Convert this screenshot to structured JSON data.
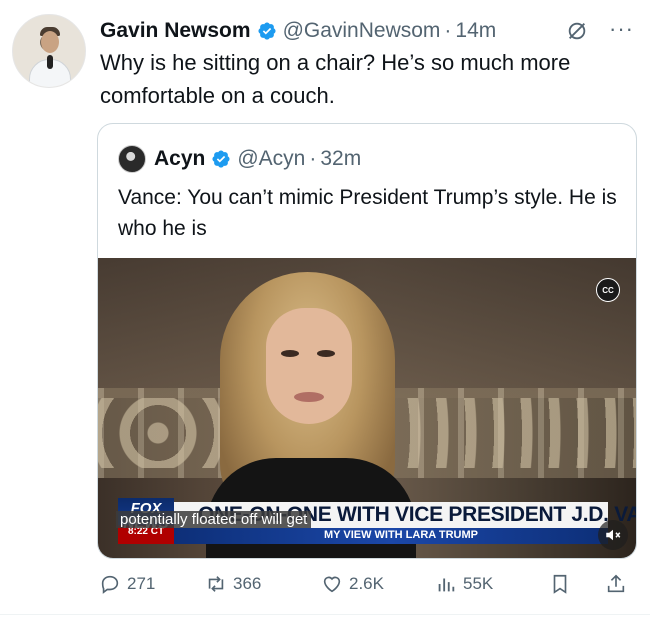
{
  "tweet": {
    "author_name": "Gavin Newsom",
    "author_handle": "@GavinNewsom",
    "separator": "·",
    "time": "14m",
    "more_label": "···",
    "text": "Why is he sitting on a chair? He’s so much more comfortable on a couch."
  },
  "quote": {
    "author_name": "Acyn",
    "author_handle": "@Acyn",
    "separator": "·",
    "time": "32m",
    "text": "Vance: You can’t mimic President Trump’s style. He is who he is"
  },
  "video": {
    "cc_label": "CC",
    "network_logo": "FOX NEWS",
    "clock": "8:22 CT",
    "headline": "ONE-ON-ONE WITH VICE PRESIDENT J.D. VANCE",
    "show_bar": "MY VIEW WITH LARA TRUMP",
    "caption": "potentially floated off will get",
    "mute_icon": "speaker-muted-icon"
  },
  "actions": {
    "replies": "271",
    "reposts": "366",
    "likes": "2.6K",
    "views": "55K"
  },
  "colors": {
    "verified_blue": "#1d9bf0",
    "text_primary": "#0f1419",
    "text_secondary": "#536471",
    "border": "#cfd9de"
  }
}
